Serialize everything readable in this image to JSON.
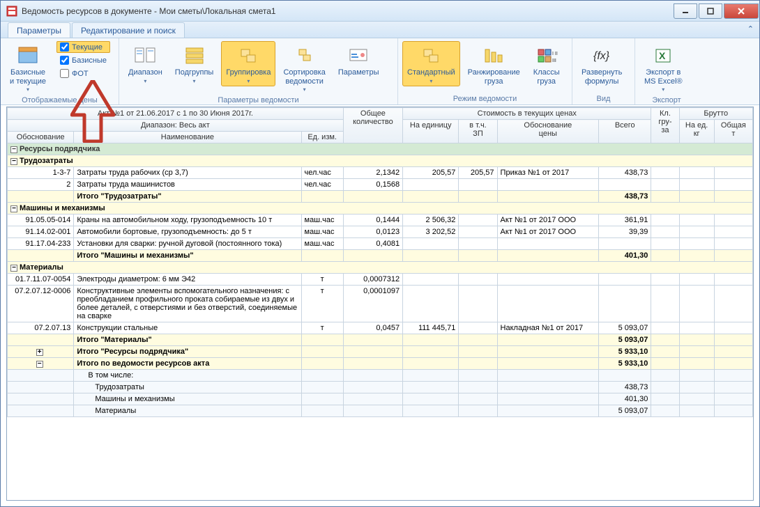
{
  "window": {
    "title": "Ведомость ресурсов в документе - Мои сметы\\Локальная смета1"
  },
  "tabs": {
    "t1": "Параметры",
    "t2": "Редактирование и поиск"
  },
  "ribbon": {
    "g1_label": "Отображаемые цены",
    "g2_label": "Параметры ведомости",
    "g3_label": "Режим ведомости",
    "g4_label": "Вид",
    "g5_label": "Экспорт",
    "btn_basic": "Базисные\nи текущие",
    "chk_current": "Текущие",
    "chk_basic": "Базисные",
    "chk_fot": "ФОТ",
    "btn_range": "Диапазон",
    "btn_subgroups": "Подгруппы",
    "btn_group": "Группировка",
    "btn_sort": "Сортировка\nведомости",
    "btn_params": "Параметры",
    "btn_std": "Стандартный",
    "btn_rank": "Ранжирование\nгруза",
    "btn_class": "Классы\nгруза",
    "btn_expand": "Развернуть\nформулы",
    "btn_export": "Экспорт в\nMS Excel®"
  },
  "header": {
    "akt": "Акт №1 от 21.06.2017 с 1 по 30 Июня 2017г.",
    "range": "Диапазон: Весь акт",
    "h_obоsn": "Обоснование",
    "h_name": "Наименование",
    "h_ed": "Ед. изм.",
    "h_qty": "Общее\nколичество",
    "h_cost": "Стоимость в текущих ценах",
    "h_unit": "На единицу",
    "h_zp": "в т.ч.\nЗП",
    "h_just": "Обоснование\nцены",
    "h_total": "Всего",
    "h_klg": "Кл.\nгру-\nза",
    "h_brutto": "Брутто",
    "h_bed": "На ед.\nкг",
    "h_bt": "Общая\nт"
  },
  "groups": {
    "g1": "Ресурсы подрядчика",
    "s1": "Трудозатраты",
    "s2": "Машины и механизмы",
    "s3": "Материалы",
    "t1": "Итого \"Трудозатраты\"",
    "t2": "Итого \"Машины и механизмы\"",
    "t3": "Итого \"Материалы\"",
    "t4": "Итого \"Ресурсы подрядчика\"",
    "t5": "Итого по ведомости ресурсов акта",
    "incl": "В том числе:",
    "i1": "Трудозатраты",
    "i2": "Машины и механизмы",
    "i3": "Материалы"
  },
  "rows": {
    "r1": {
      "ob": "1-3-7",
      "name": "Затраты труда рабочих (ср 3,7)",
      "ed": "чел.час",
      "qty": "2,1342",
      "unit": "205,57",
      "zp": "205,57",
      "just": "Приказ №1 от 2017",
      "total": "438,73"
    },
    "r2": {
      "ob": "2",
      "name": "Затраты труда машинистов",
      "ed": "чел.час",
      "qty": "0,1568"
    },
    "r3": {
      "ob": "91.05.05-014",
      "name": "Краны на автомобильном ходу, грузоподъемность 10 т",
      "ed": "маш.час",
      "qty": "0,1444",
      "unit": "2 506,32",
      "just": "Акт №1 от 2017 ООО",
      "total": "361,91"
    },
    "r4": {
      "ob": "91.14.02-001",
      "name": "Автомобили бортовые, грузоподъемность: до 5 т",
      "ed": "маш.час",
      "qty": "0,0123",
      "unit": "3 202,52",
      "just": "Акт №1 от 2017 ООО",
      "total": "39,39"
    },
    "r5": {
      "ob": "91.17.04-233",
      "name": "Установки для сварки: ручной дуговой (постоянного тока)",
      "ed": "маш.час",
      "qty": "0,4081"
    },
    "r6": {
      "ob": "01.7.11.07-0054",
      "name": "Электроды диаметром: 6 мм Э42",
      "ed": "т",
      "qty": "0,0007312"
    },
    "r7": {
      "ob": "07.2.07.12-0006",
      "name": "Конструктивные элементы вспомогательного назначения: с преобладанием профильного проката собираемые из двух и более деталей, с отверстиями и без отверстий, соединяемые на сварке",
      "ed": "т",
      "qty": "0,0001097"
    },
    "r8": {
      "ob": "07.2.07.13",
      "name": "Конструкции стальные",
      "ed": "т",
      "qty": "0,0457",
      "unit": "111 445,71",
      "just": "Накладная №1 от 2017",
      "total": "5 093,07"
    }
  },
  "totals": {
    "t1": "438,73",
    "t2": "401,30",
    "t3": "5 093,07",
    "t4": "5 933,10",
    "t5": "5 933,10",
    "i1": "438,73",
    "i2": "401,30",
    "i3": "5 093,07"
  }
}
